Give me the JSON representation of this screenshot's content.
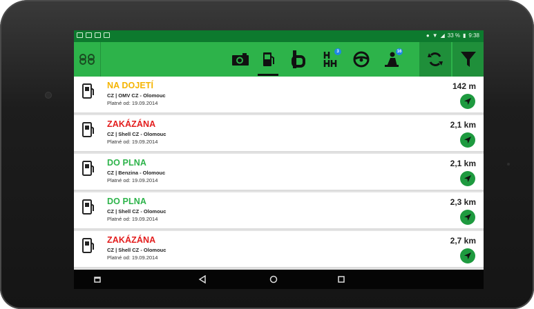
{
  "status_bar": {
    "battery": "33 %",
    "time": "9:38"
  },
  "toolbar": {
    "badges": {
      "stations": "3",
      "road": "16"
    }
  },
  "colors": {
    "green": "#2db34a",
    "yellow": "#f5b400",
    "red": "#e31d1d",
    "ok": "#2db34a"
  },
  "list": [
    {
      "title": "NA DOJETÍ",
      "title_color": "#f5b400",
      "station": "CZ | OMV CZ - Olomouc",
      "valid": "Platné od: 19.09.2014",
      "distance": "142 m"
    },
    {
      "title": "ZAKÁZÁNA",
      "title_color": "#e31d1d",
      "station": "CZ | Shell CZ - Olomouc",
      "valid": "Platné od: 19.09.2014",
      "distance": "2,1 km"
    },
    {
      "title": "DO PLNA",
      "title_color": "#2db34a",
      "station": "CZ | Benzina - Olomouc",
      "valid": "Platné od: 19.09.2014",
      "distance": "2,1 km"
    },
    {
      "title": "DO PLNA",
      "title_color": "#2db34a",
      "station": "CZ | Shell CZ - Olomouc",
      "valid": "Platné od: 19.09.2014",
      "distance": "2,3 km"
    },
    {
      "title": "ZAKÁZÁNA",
      "title_color": "#e31d1d",
      "station": "CZ | Shell CZ - Olomouc",
      "valid": "Platné od: 19.09.2014",
      "distance": "2,7 km"
    }
  ]
}
